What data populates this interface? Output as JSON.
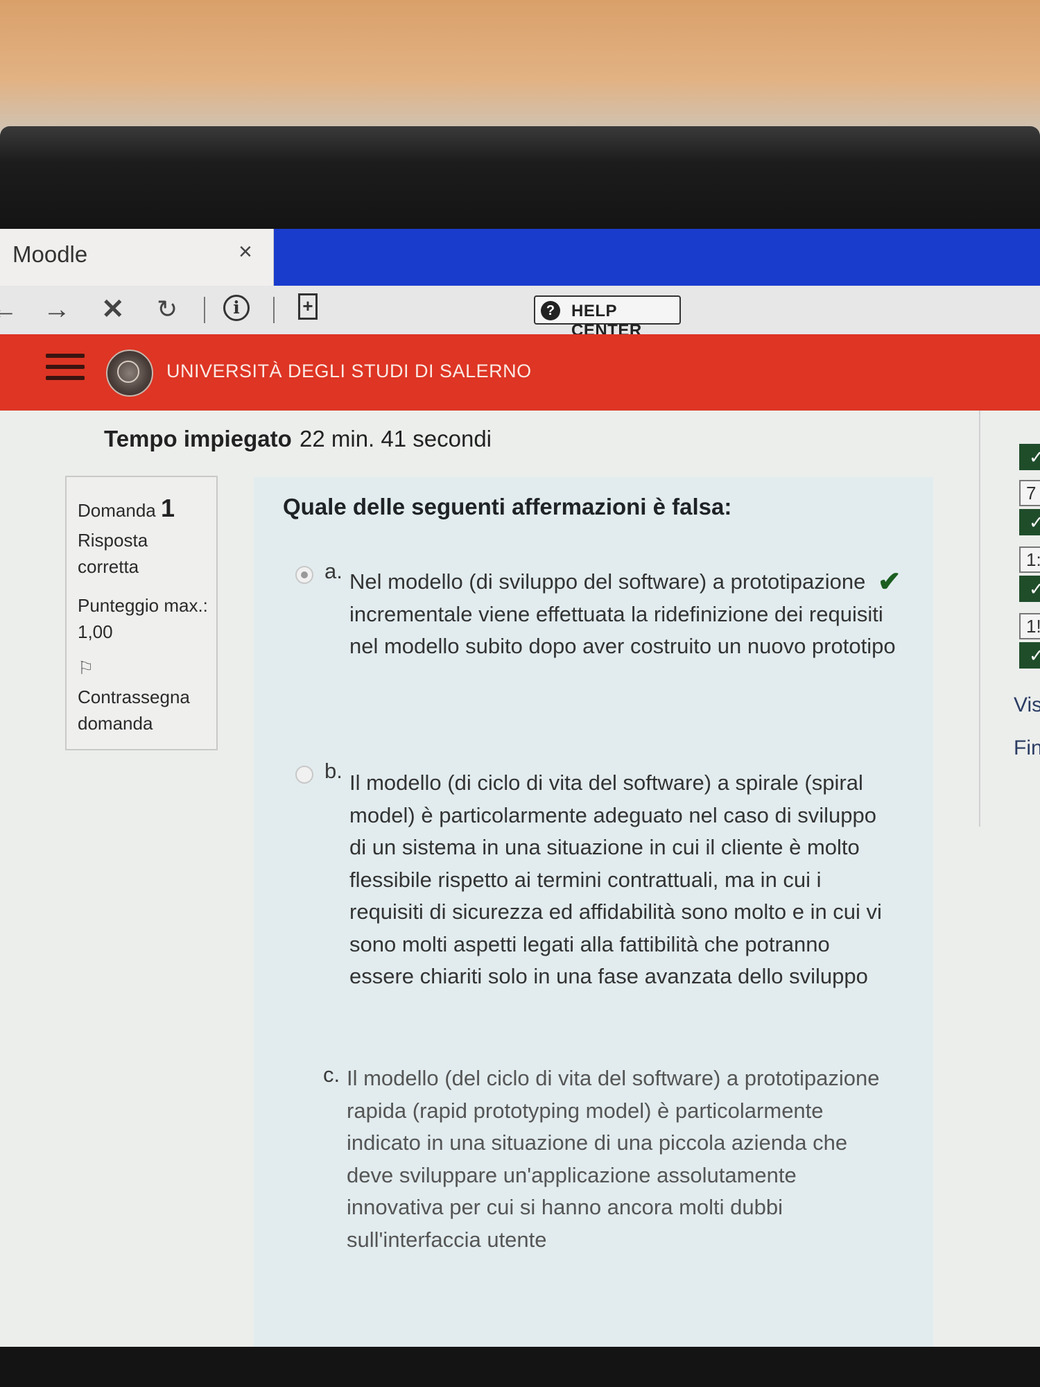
{
  "browser": {
    "tab_title": "Moodle",
    "tab_close_glyph": "×",
    "help_label": "HELP CENTER"
  },
  "header": {
    "university": "UNIVERSITÀ DEGLI STUDI DI SALERNO"
  },
  "attempt": {
    "time_label": "Tempo impiegato",
    "time_value": "22 min. 41 secondi"
  },
  "question_info": {
    "label": "Domanda",
    "number": "1",
    "status_line1": "Risposta",
    "status_line2": "corretta",
    "score_label": "Punteggio max.:",
    "score_value": "1,00",
    "flag_line1": "Contrassegna",
    "flag_line2": "domanda"
  },
  "question": {
    "text": "Quale delle seguenti affermazioni è falsa:",
    "options": [
      {
        "letter": "a.",
        "text": "Nel modello (di sviluppo del software) a prototipazione incrementale viene effettuata la ridefinizione dei requisiti nel modello subito dopo aver costruito un nuovo prototipo",
        "selected": true,
        "correct": true
      },
      {
        "letter": "b.",
        "text": "Il modello (di ciclo di vita del software) a spirale (spiral model) è particolarmente adeguato nel caso di sviluppo di un sistema in una situazione in cui il cliente è molto flessibile rispetto ai termini contrattuali, ma in cui i requisiti di sicurezza ed affidabilità sono molto e in cui vi sono molti aspetti legati alla fattibilità che potranno essere chiariti solo in una fase avanzata dello sviluppo",
        "selected": false
      },
      {
        "letter": "c.",
        "text": "Il modello (del ciclo di vita del software) a prototipazione rapida (rapid prototyping model) è particolarmente indicato in una situazione di una piccola azienda che deve sviluppare un'applicazione assolutamente innovativa per cui si hanno ancora molti dubbi sull'interfaccia utente",
        "selected": false
      }
    ]
  },
  "quiz_nav": {
    "partial_numbers": [
      "7",
      "1:",
      "1!"
    ],
    "link_view": "Vis",
    "link_finish": "Fin"
  },
  "colors": {
    "tab_strip": "#1a3ccc",
    "header_red": "#de3524",
    "correct_check": "#1b5e20"
  }
}
